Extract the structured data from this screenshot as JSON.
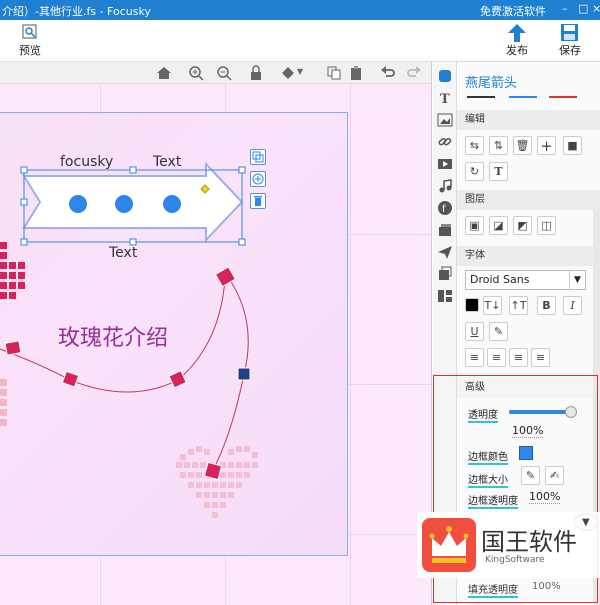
{
  "window": {
    "title": "介绍）-其他行业.fs - Focusky",
    "free_label": "免费激活软件"
  },
  "toolbar": {
    "preview_label": "预览",
    "publish_label": "发布",
    "save_label": "保存"
  },
  "canvas": {
    "label_focusky": "focusky",
    "label_text_top": "Text",
    "label_text_bottom": "Text",
    "rose_title": "玫瑰花介绍"
  },
  "props": {
    "title": "燕尾箭头",
    "section_edit": "编辑",
    "section_layer": "图层",
    "section_font": "字体",
    "font_name": "Droid Sans",
    "section_advanced": "高级",
    "opacity_label": "透明度",
    "opacity_value": "100%",
    "border_color_label": "边框颜色",
    "border_size_label": "边框大小",
    "border_opacity_label": "边框透明度",
    "border_opacity_value": "100%",
    "fill_opacity_label": "填充透明度",
    "fill_opacity_value": "100%",
    "opacity_level": 1.0
  },
  "watermark": {
    "brand": "国王软件",
    "sub": "KingSoftware"
  },
  "colors": {
    "titlebar": "#1f7fd0",
    "accent": "#2ac9c9",
    "highlight_box": "#e03030",
    "rose": "#9a2d9a"
  }
}
